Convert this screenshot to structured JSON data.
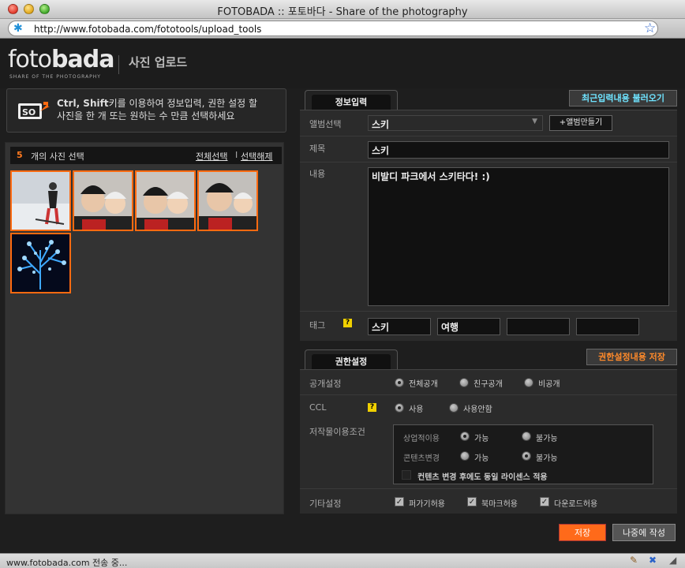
{
  "window": {
    "title": "FOTOBADA :: 포토바다 - Share of the photography"
  },
  "browser": {
    "url": "http://www.fotobada.com/fototools/upload_tools"
  },
  "header": {
    "logo_light": "foto",
    "logo_bold": "bada",
    "logo_sub": "SHARE OF THE PHOTOGRAPHY",
    "page_title": "사진 업로드"
  },
  "info": {
    "line1_bold": "Ctrl, Shift",
    "line1_rest": "키를  이용하여 정보입력, 권한 설정 할",
    "line2": "사진을 한 개 또는 원하는 수 만큼 선택하세요"
  },
  "selection": {
    "count": "5",
    "label": "개의 사진 선택",
    "select_all": "전체선택",
    "separator": "I",
    "deselect": "선택해제"
  },
  "tabs": {
    "info": "정보입력",
    "perm": "권한설정"
  },
  "buttons": {
    "recent": "최근입력내용 불러오기",
    "make_album": "+앨범만들기",
    "perm_save": "권한설정내용 저장",
    "save": "저장",
    "later": "나중에 작성"
  },
  "form": {
    "album_label": "앨범선택",
    "album_value": "스키",
    "title_label": "제목",
    "title_value": "스키",
    "content_label": "내용",
    "content_value": "비발디 파크에서 스키타다! :)",
    "tag_label": "태그",
    "tags": [
      "스키",
      "여행",
      "",
      ""
    ]
  },
  "perm": {
    "public_label": "공개설정",
    "public_options": [
      "전체공개",
      "친구공개",
      "비공개"
    ],
    "ccl_label": "CCL",
    "ccl_options": [
      "사용",
      "사용안함"
    ],
    "cond_label": "저작물이용조건",
    "commercial_label": "상업적이용",
    "modify_label": "콘텐츠변경",
    "allow": "가능",
    "deny": "불가능",
    "same_license": "컨텐츠 변경 후에도 동일 라이센스 적용",
    "etc_label": "기타설정",
    "etc_options": [
      "퍼가기허용",
      "북마크허용",
      "다운로드허용"
    ]
  },
  "help_glyph": "?",
  "status": {
    "text": "www.fotobada.com 전송 중..."
  },
  "colors": {
    "accent": "#ff6a10",
    "recent_text": "#6fe3ff",
    "perm_save_text": "#ff8a2a"
  }
}
